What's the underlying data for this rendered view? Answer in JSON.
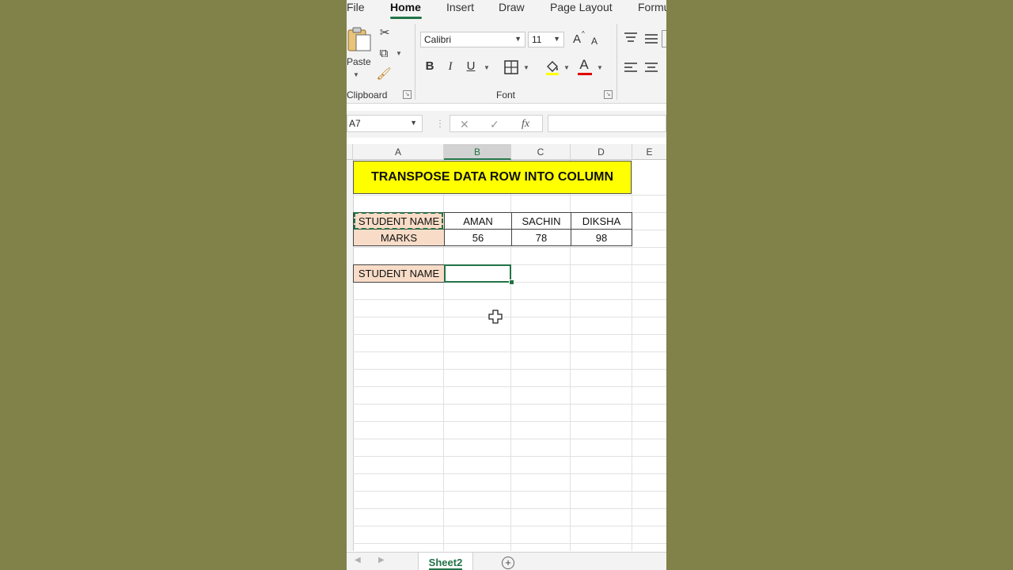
{
  "ribbon_tabs": [
    "File",
    "Home",
    "Insert",
    "Draw",
    "Page Layout",
    "Formu"
  ],
  "clipboard": {
    "paste_label": "Paste",
    "group_label": "Clipboard"
  },
  "font": {
    "name": "Calibri",
    "size": "11",
    "group_label": "Font",
    "bold": "B",
    "italic": "I",
    "underline": "U",
    "font_color_letter": "A",
    "grow_font": "A",
    "shrink_font": "A"
  },
  "formula_bar": {
    "name_box": "A7",
    "fx": "fx",
    "value": ""
  },
  "columns": [
    "A",
    "B",
    "C",
    "D",
    "E"
  ],
  "selected_column": "B",
  "sheet": {
    "title": "TRANSPOSE DATA ROW INTO COLUMN",
    "table": {
      "header_row": [
        "STUDENT NAME",
        "AMAN",
        "SACHIN",
        "DIKSHA"
      ],
      "marks_row": [
        "MARKS",
        "56",
        "78",
        "98"
      ]
    },
    "transpose_label": "STUDENT NAME"
  },
  "sheet_tabs": [
    "Sheet2"
  ],
  "colors": {
    "accent": "#217346",
    "title_fill": "#ffff00",
    "label_fill": "#f8dcc7",
    "backdrop": "#808249"
  }
}
